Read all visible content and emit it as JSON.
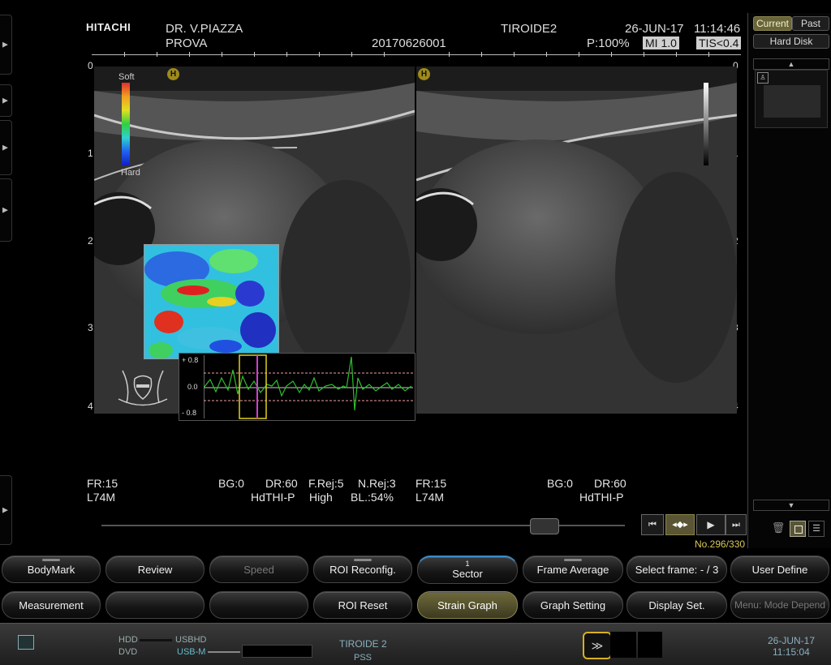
{
  "header": {
    "logo": "HITACHI",
    "doctor": "DR. V.PIAZZA",
    "patient": "PROVA",
    "exam_id": "20170626001",
    "preset": "TIROIDE2",
    "date": "26-JUN-17",
    "time": "11:14:46",
    "power": "P:100%",
    "mi": "MI 1.0",
    "tis": "TIS<0.4"
  },
  "image": {
    "depth_labels": [
      "0",
      "1",
      "2",
      "3",
      "4"
    ],
    "focus_marker": "H",
    "elasto_scale": {
      "top": "Soft",
      "bottom": "Hard"
    },
    "strain_graph": {
      "y_labels": [
        "+ 0.8",
        "0.0",
        "- 0.8"
      ]
    }
  },
  "params": {
    "left": {
      "fr": "FR:15",
      "probe": "L74M",
      "bg": "BG:0",
      "dr": "DR:60",
      "thi": "HdTHI-P",
      "frej": "F.Rej:5",
      "frej_val": "High",
      "nrej": "N.Rej:3",
      "bl": "BL.:54%"
    },
    "right": {
      "fr": "FR:15",
      "probe": "L74M",
      "bg": "BG:0",
      "dr": "DR:60",
      "thi": "HdTHI-P"
    }
  },
  "cine": {
    "frame_counter": "No.296/330",
    "progress": 0.845
  },
  "side_panel": {
    "tab_current": "Current",
    "tab_past": "Past",
    "storage": "Hard Disk"
  },
  "buttons": {
    "row1": [
      "BodyMark",
      "Review",
      "Speed",
      "ROI Reconfig.",
      "Sector",
      "Frame Average",
      "Select frame: - / 3",
      "User Define"
    ],
    "sector_index": "1",
    "row2": [
      "Measurement",
      "",
      "",
      "ROI Reset",
      "Strain Graph",
      "Graph Setting",
      "Display Set.",
      "Menu: Mode Depend"
    ]
  },
  "footer": {
    "hdd": "HDD",
    "usbhd": "USBHD",
    "dvd": "DVD",
    "usbm": "USB-M",
    "preset": "TIROIDE 2",
    "pss": "PSS",
    "date": "26-JUN-17",
    "time": "11:15:04"
  },
  "colors": {
    "accent_yellow": "#d8c85a",
    "strain_line": "#2fbf2f",
    "roi_box": "#e0d020",
    "cursor": "#d040d0"
  }
}
